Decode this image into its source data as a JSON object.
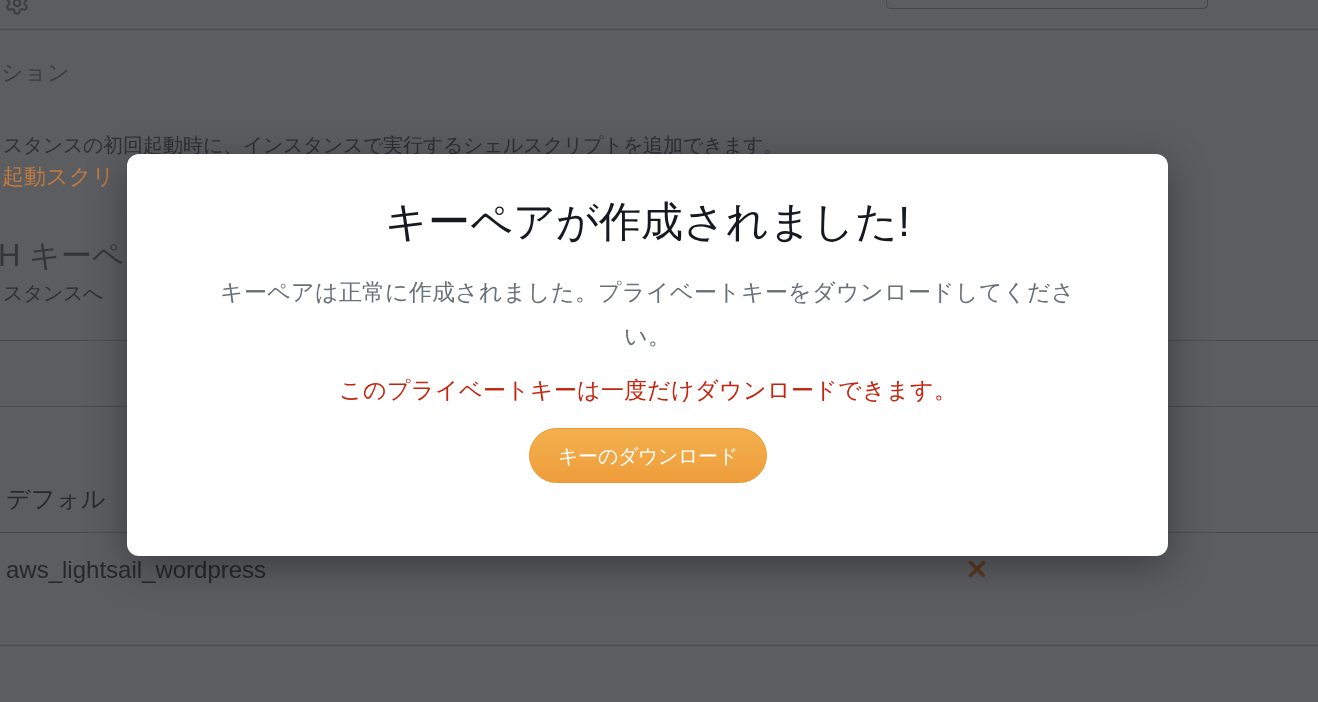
{
  "section_heading": "ション",
  "description": "スタンスの初回起動時に、インスタンスで実行するシェルスクリプトを追加できます。",
  "launch_script_link": "起動スクリ",
  "ssh_heading": "H キーペ",
  "ssh_description": "スタンスへ",
  "key_pairs": [
    {
      "name": "デフォル"
    },
    {
      "name": "aws_lightsail_wordpress"
    }
  ],
  "dialog": {
    "title": "キーペアが作成されました!",
    "message": "キーペアは正常に作成されました。プライベートキーをダウンロードしてください。",
    "warning": "このプライベートキーは一度だけダウンロードできます。",
    "download_button": "キーのダウンロード"
  }
}
